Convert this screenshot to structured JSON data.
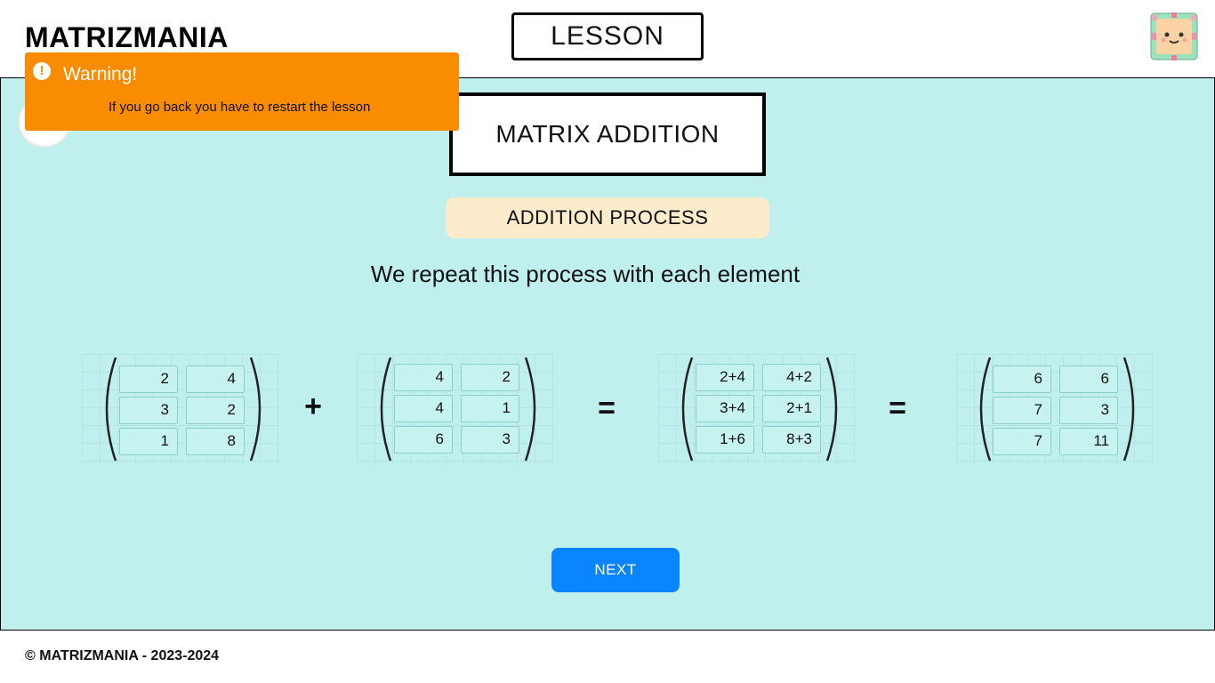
{
  "header": {
    "brand": "MATRIZMANIA",
    "section": "LESSON"
  },
  "toast": {
    "title": "Warning!",
    "message": "If you go back you have to restart the lesson",
    "icon": "exclamation-icon",
    "color": "#f98c00"
  },
  "lesson": {
    "title": "MATRIX ADDITION",
    "step": "ADDITION PROCESS",
    "instruction": "We repeat this process with each element",
    "matrices": {
      "a": [
        [
          "2",
          "4"
        ],
        [
          "3",
          "2"
        ],
        [
          "1",
          "8"
        ]
      ],
      "b": [
        [
          "4",
          "2"
        ],
        [
          "4",
          "1"
        ],
        [
          "6",
          "3"
        ]
      ],
      "sum_expr": [
        [
          "2+4",
          "4+2"
        ],
        [
          "3+4",
          "2+1"
        ],
        [
          "1+6",
          "8+3"
        ]
      ],
      "result": [
        [
          "6",
          "6"
        ],
        [
          "7",
          "3"
        ],
        [
          "7",
          "11"
        ]
      ]
    },
    "operators": {
      "plus": "+",
      "equals1": "=",
      "equals2": "="
    },
    "next_label": "NEXT"
  },
  "footer": {
    "copyright": "© MATRIZMANIA - 2023-2024"
  },
  "colors": {
    "panel": "#c0f0ee",
    "accent": "#0a84ff",
    "pill": "#fdeccb"
  }
}
